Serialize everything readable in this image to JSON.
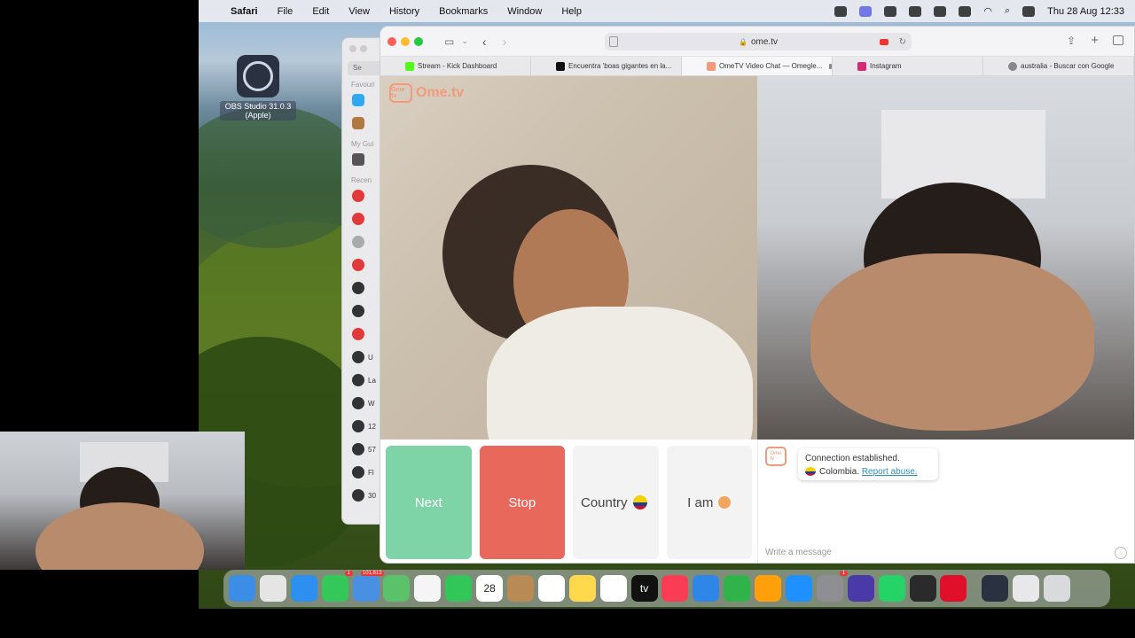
{
  "menubar": {
    "app_name": "Safari",
    "menus": [
      "File",
      "Edit",
      "View",
      "History",
      "Bookmarks",
      "Window",
      "Help"
    ],
    "clock": "Thu 28 Aug  12:33"
  },
  "desktop": {
    "obs_label": "OBS Studio 31.0.3 (Apple)"
  },
  "finder_sidebar": {
    "section_favourites": "Favouri",
    "section_guides": "My Gui",
    "section_recents": "Recen",
    "search_placeholder": "Se",
    "recents_labels": [
      "U",
      "La",
      "W",
      "12",
      "57",
      "Fl",
      "30"
    ]
  },
  "safari": {
    "address": "ome.tv",
    "tabs": [
      {
        "label": "Stream - Kick Dashboard",
        "color": "#53fc18"
      },
      {
        "label": "Encuentra 'boas gigantes en la...",
        "color": "#111111"
      },
      {
        "label": "OmeTV Video Chat — Omegle...",
        "color": "#f29a7c",
        "active": true
      },
      {
        "label": "Instagram",
        "color": "#d62976"
      },
      {
        "label": "australia - Buscar con Google",
        "color": "#888888"
      }
    ]
  },
  "ometv": {
    "logo_text": "Ome.tv",
    "logo_badge": "Ome tv",
    "buttons": {
      "next": "Next",
      "stop": "Stop",
      "country": "Country",
      "iam": "I am"
    },
    "chat": {
      "connection_text": "Connection established.",
      "country": "Colombia.",
      "report_link": "Report abuse.",
      "message_placeholder": "Write a message"
    }
  },
  "dock": {
    "apps": [
      {
        "name": "finder-icon",
        "color": "#3b8de6"
      },
      {
        "name": "launchpad-icon",
        "color": "#e5e5e5"
      },
      {
        "name": "safari-icon",
        "color": "#2d8ff0"
      },
      {
        "name": "messages-icon",
        "color": "#34c759",
        "badge": "1"
      },
      {
        "name": "mail-icon",
        "color": "#4a90e2",
        "badge": "101,813"
      },
      {
        "name": "maps-icon",
        "color": "#5bc16a"
      },
      {
        "name": "photos-icon",
        "color": "#f5f5f5"
      },
      {
        "name": "facetime-icon",
        "color": "#33c759"
      },
      {
        "name": "calendar-icon",
        "color": "#ffffff",
        "label": "28"
      },
      {
        "name": "contacts-icon",
        "color": "#b88a55"
      },
      {
        "name": "reminders-icon",
        "color": "#ffffff"
      },
      {
        "name": "notes-icon",
        "color": "#ffd84d"
      },
      {
        "name": "freeform-icon",
        "color": "#ffffff"
      },
      {
        "name": "appletv-icon",
        "color": "#111111",
        "label": "tv"
      },
      {
        "name": "music-icon",
        "color": "#fa3c55"
      },
      {
        "name": "keynote-icon",
        "color": "#2f86e8"
      },
      {
        "name": "numbers-icon",
        "color": "#2fb34a"
      },
      {
        "name": "pages-icon",
        "color": "#ff9f0a"
      },
      {
        "name": "appstore-icon",
        "color": "#1e90ff"
      },
      {
        "name": "settings-icon",
        "color": "#8e8e93",
        "badge": "1"
      },
      {
        "name": "affinity-icon",
        "color": "#4a3aa8"
      },
      {
        "name": "whatsapp-icon",
        "color": "#25d366"
      },
      {
        "name": "obs-dock-icon",
        "color": "#2a2a2a"
      },
      {
        "name": "opera-icon",
        "color": "#e0102a"
      },
      {
        "name": "obs-dock-icon-2",
        "color": "#2a3140"
      },
      {
        "name": "screenshots-folder-icon",
        "color": "#e8e8ea"
      },
      {
        "name": "trash-icon",
        "color": "#d9dadc"
      }
    ]
  }
}
